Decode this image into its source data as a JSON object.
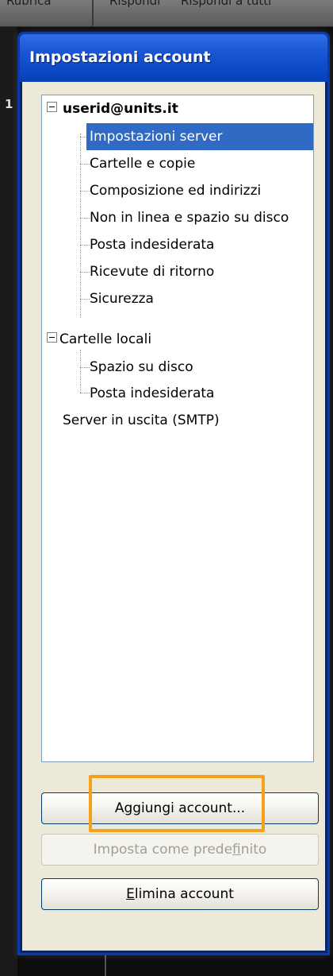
{
  "background_toolbar": {
    "items": [
      "Rubrica",
      "Rispondi",
      "Rispondi a tutti"
    ]
  },
  "background_left_glyph": "1",
  "dialog": {
    "title": "Impostazioni account"
  },
  "tree": {
    "account": {
      "label": "userid@units.it",
      "expanded": true,
      "children": [
        {
          "label": "Impostazioni server",
          "selected": true
        },
        {
          "label": "Cartelle e copie",
          "selected": false
        },
        {
          "label": "Composizione ed indirizzi",
          "selected": false
        },
        {
          "label": "Non in linea e spazio su disco",
          "selected": false
        },
        {
          "label": "Posta indesiderata",
          "selected": false
        },
        {
          "label": "Ricevute di ritorno",
          "selected": false
        },
        {
          "label": "Sicurezza",
          "selected": false
        }
      ]
    },
    "local": {
      "label": "Cartelle locali",
      "expanded": true,
      "children": [
        {
          "label": "Spazio su disco"
        },
        {
          "label": "Posta indesiderata"
        }
      ]
    },
    "smtp": {
      "label": "Server in uscita (SMTP)"
    }
  },
  "buttons": {
    "add_account": {
      "pre": "A",
      "mnemonic": "g",
      "post": "giungi account...",
      "enabled": true,
      "highlighted": true
    },
    "set_default": {
      "pre": "Imposta come prede",
      "mnemonic": "f",
      "post": "inito",
      "enabled": false
    },
    "delete_account": {
      "pre": "",
      "mnemonic": "E",
      "post": "limina account",
      "enabled": true
    }
  },
  "colors": {
    "titlebar": "#0c4bc9",
    "selection": "#316ac5",
    "highlight_box": "#f4a21c",
    "dialog_face": "#ece9d8"
  }
}
